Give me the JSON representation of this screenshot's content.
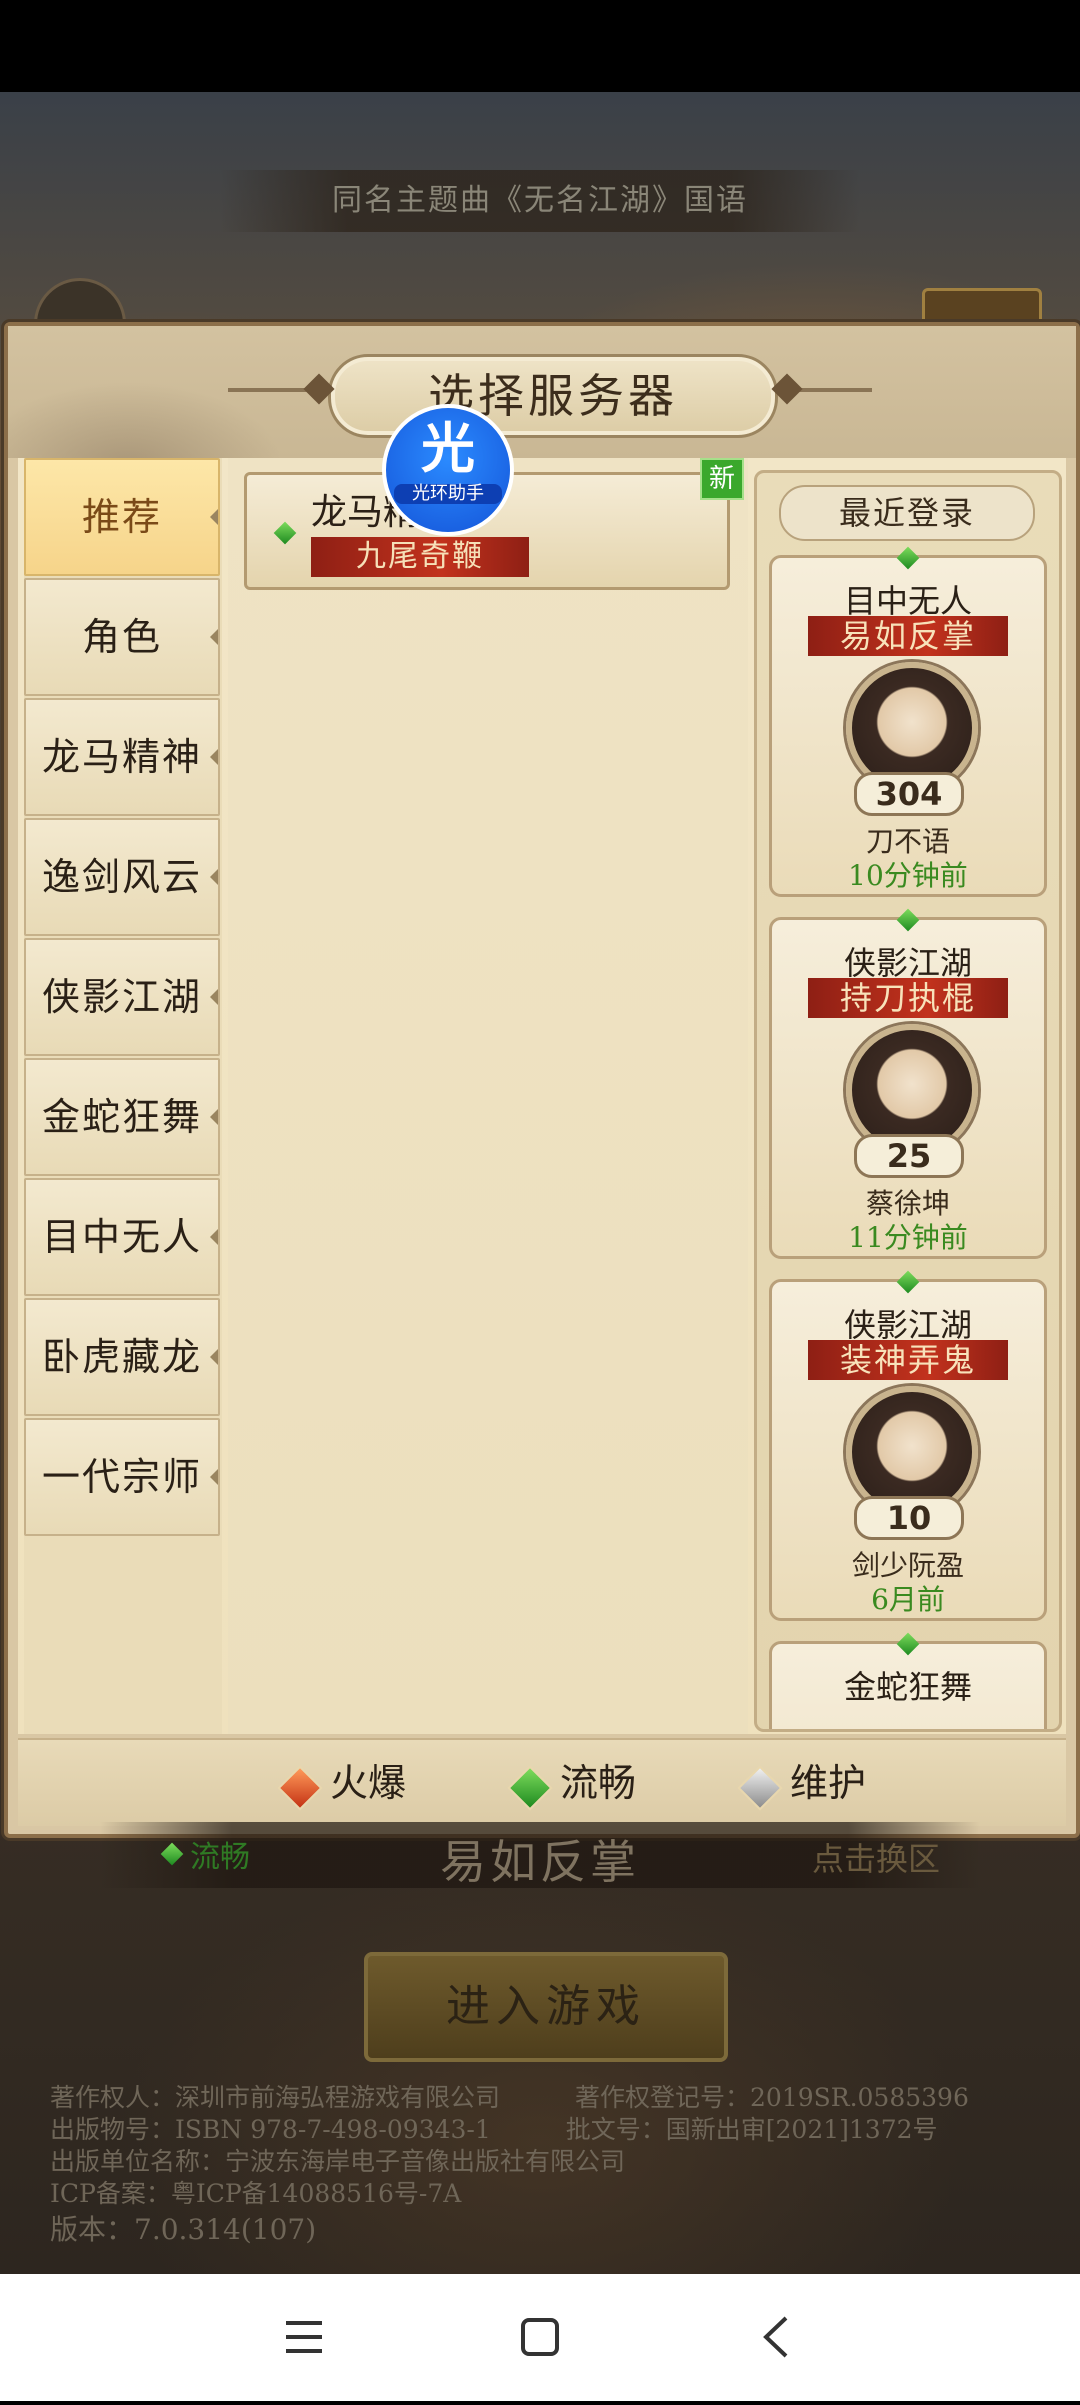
{
  "banner": {
    "text": "同名主题曲《无名江湖》国语"
  },
  "dialog": {
    "title": "选择服务器",
    "tabs": [
      {
        "label": "推荐",
        "active": true
      },
      {
        "label": "角色",
        "active": false
      },
      {
        "label": "龙马精神",
        "active": false
      },
      {
        "label": "逸剑风云",
        "active": false
      },
      {
        "label": "侠影江湖",
        "active": false
      },
      {
        "label": "金蛇狂舞",
        "active": false
      },
      {
        "label": "目中无人",
        "active": false
      },
      {
        "label": "卧虎藏龙",
        "active": false
      },
      {
        "label": "一代宗师",
        "active": false
      }
    ],
    "server": {
      "name": "龙马精神",
      "zone": "九尾奇鞭",
      "badge": "新",
      "status": "流畅"
    },
    "helper": {
      "big": "光",
      "small": "光环助手"
    },
    "recent": {
      "title": "最近登录",
      "cards": [
        {
          "server": "目中无人",
          "zone": "易如反掌",
          "level": "304",
          "character": "刀不语",
          "time": "10分钟前"
        },
        {
          "server": "侠影江湖",
          "zone": "持刀执棍",
          "level": "25",
          "character": "蔡徐坤",
          "time": "11分钟前"
        },
        {
          "server": "侠影江湖",
          "zone": "装神弄鬼",
          "level": "10",
          "character": "剑少阮盈",
          "time": "6月前"
        },
        {
          "server": "金蛇狂舞",
          "zone": "",
          "level": "",
          "character": "",
          "time": ""
        }
      ]
    },
    "legend": {
      "hot": "火爆",
      "smooth": "流畅",
      "maintain": "维护"
    }
  },
  "footer": {
    "status": "流畅",
    "zone": "易如反掌",
    "switch": "点击换区",
    "enter": "进入游戏",
    "legal": [
      "著作权人：深圳市前海弘程游戏有限公司　　　著作权登记号：2019SR.0585396",
      "出版物号：ISBN 978-7-498-09343-1　　　批文号：国新出审[2021]1372号",
      "出版单位名称：宁波东海岸电子音像出版社有限公司",
      "ICP备案：粤ICP备14088516号-7A",
      "版本：7.0.314(107)"
    ]
  },
  "colors": {
    "accent_red": "#c2321d",
    "status_green": "#3a8a20",
    "parchment": "#f2e6c7"
  }
}
